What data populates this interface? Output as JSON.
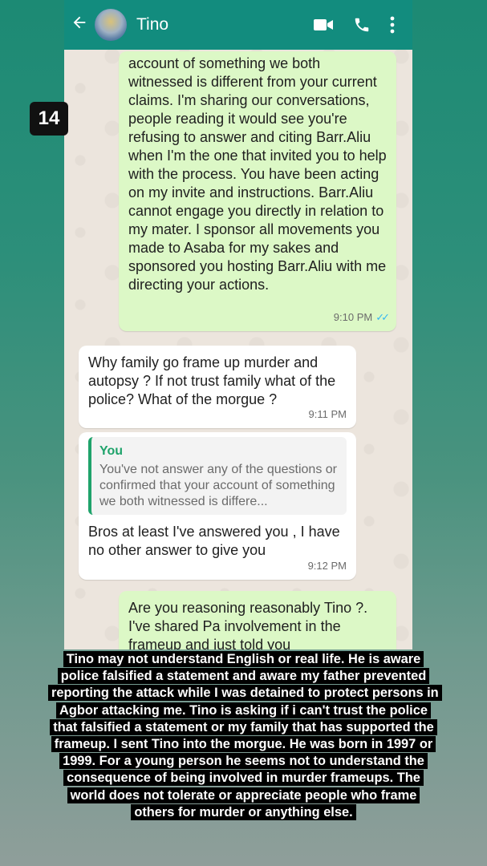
{
  "header": {
    "contact_name": "Tino"
  },
  "badge": "14",
  "messages": [
    {
      "direction": "outgoing",
      "text": "account of something we both witnessed is different from your current claims. I'm sharing our conversations, people reading it would see you're refusing to answer and citing Barr.Aliu when I'm the one that invited you to help with the process. You have been acting on my invite and instructions. Barr.Aliu cannot engage you directly in relation to my mater. I sponsor all movements you made to Asaba for my sakes and sponsored you hosting Barr.Aliu with me directing your actions.",
      "time": "9:10 PM",
      "status": "read"
    },
    {
      "direction": "incoming",
      "text": "Why family go frame up murder and autopsy ? If not trust family what of the police? What of the morgue ?",
      "time": "9:11 PM"
    },
    {
      "direction": "incoming",
      "quote_name": "You",
      "quote_text": "You've not answer any of the questions or confirmed that your account of something we both witnessed is differe...",
      "text": "Bros at least I've answered you , I have no other answer to give you",
      "time": "9:12 PM"
    },
    {
      "direction": "outgoing",
      "text": "Are you reasoning reasonably Tino ?. I've shared Pa involvement in the frameup and just told you"
    }
  ],
  "caption": "Tino may not understand English or real life. He is aware police falsified a statement and aware my father prevented reporting the attack while I was detained to protect persons in Agbor attacking me. Tino is asking if i can't trust the police that falsified a statement or my family that has supported the frameup. I sent Tino into the morgue. He was born in 1997 or 1999. For a young person he seems not to understand the consequence of being involved in murder frameups. The world does not tolerate or appreciate people who frame others for murder or anything else.",
  "icons": {
    "back": "arrow-left-icon",
    "video": "video-call-icon",
    "call": "phone-icon",
    "menu": "more-vert-icon",
    "read_status": "double-check-icon"
  },
  "colors": {
    "header": "#128c7e",
    "outgoing_bubble": "#dcf8c6",
    "incoming_bubble": "#ffffff",
    "read_ticks": "#34b7f1",
    "quote_accent": "#1fa36b"
  }
}
